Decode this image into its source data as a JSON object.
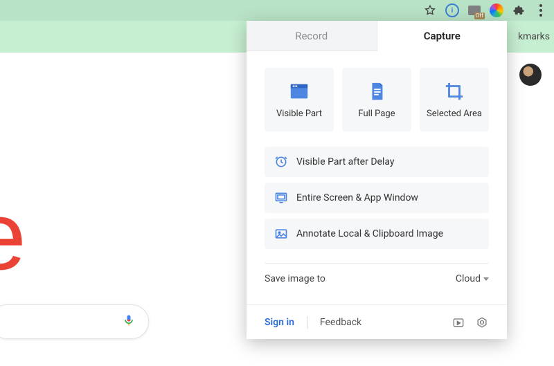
{
  "chrome": {
    "off_badge": "Off",
    "bookmarks_label": "kmarks"
  },
  "page": {
    "logo_fragment": "e"
  },
  "popup": {
    "tabs": {
      "record": "Record",
      "capture": "Capture"
    },
    "cards": {
      "visible_part": "Visible Part",
      "full_page": "Full Page",
      "selected_area": "Selected Area"
    },
    "list": {
      "visible_delay": "Visible Part after Delay",
      "entire_window": "Entire Screen & App Window",
      "annotate_local": "Annotate Local & Clipboard Image"
    },
    "save_label": "Save image to",
    "save_dest": "Cloud",
    "footer": {
      "signin": "Sign in",
      "feedback": "Feedback"
    }
  }
}
